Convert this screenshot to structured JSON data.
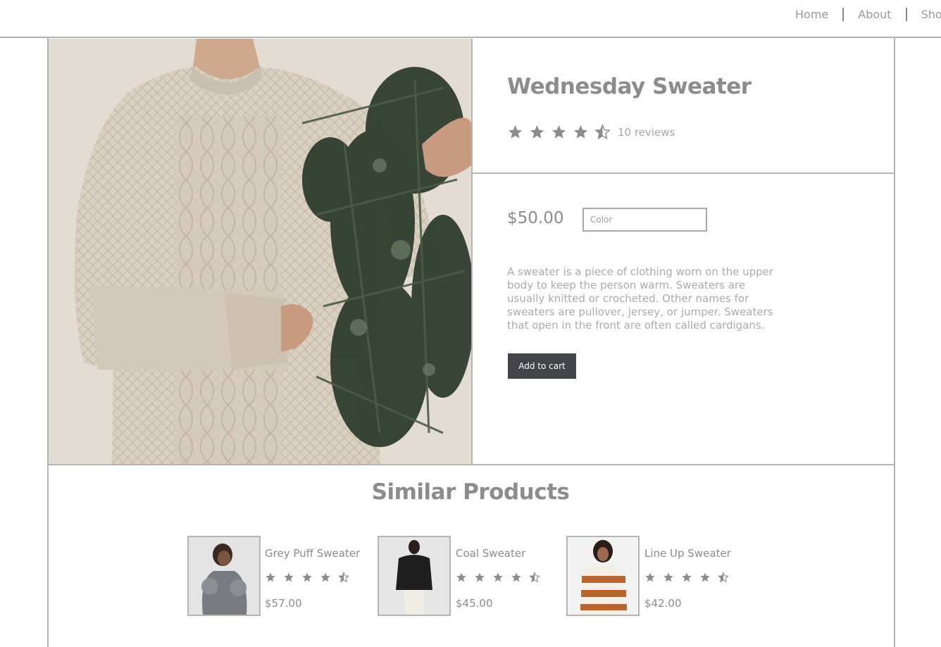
{
  "nav": {
    "items": [
      "Home",
      "About",
      "Shop"
    ]
  },
  "product": {
    "title": "Wednesday Sweater",
    "rating": 4.5,
    "reviews_label": "10 reviews",
    "price": "$50.00",
    "color_placeholder": "Color",
    "description": "A sweater is a piece of clothing worn on the upper body to keep the person warm. Sweaters are usually knitted or crocheted. Other names for sweaters are pullover, jersey, or jumper. Sweaters that open in the front are often called cardigans.",
    "add_to_cart_label": "Add to cart"
  },
  "similar": {
    "heading": "Similar Products",
    "items": [
      {
        "name": "Grey Puff Sweater",
        "rating": 4.5,
        "price": "$57.00"
      },
      {
        "name": "Coal Sweater",
        "rating": 4.5,
        "price": "$45.00"
      },
      {
        "name": "Line Up Sweater",
        "rating": 4.5,
        "price": "$42.00"
      }
    ]
  },
  "colors": {
    "star": "#8c8c8c",
    "button_bg": "#414448",
    "border": "#b4b4b4"
  },
  "icons": {
    "rating": "star-icon",
    "half_rating": "star-half-icon"
  }
}
